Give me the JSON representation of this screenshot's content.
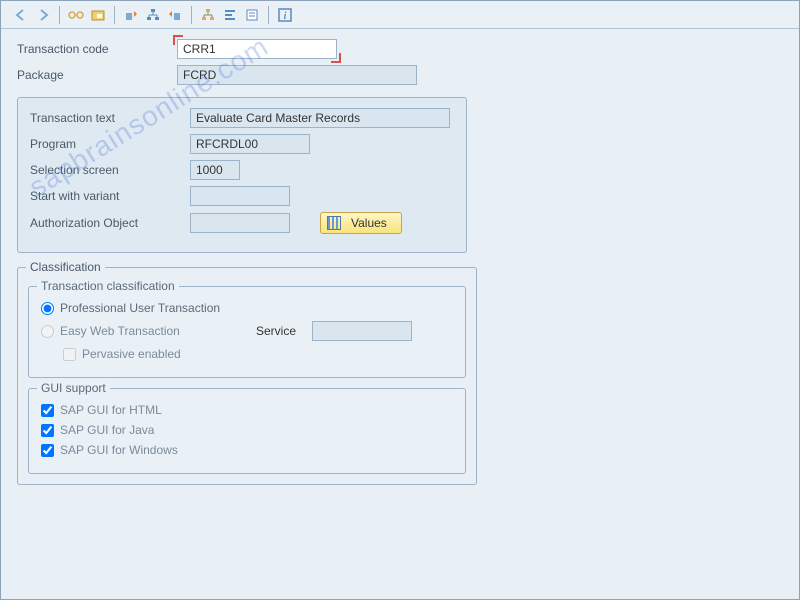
{
  "watermark": "sapbrainsonline.com",
  "toolbar": {
    "icons": [
      "back",
      "forward",
      "glasses",
      "folder-tree",
      "export",
      "hierarchy",
      "import2",
      "org",
      "align-left",
      "template",
      "info"
    ]
  },
  "header": {
    "tcode_label": "Transaction code",
    "tcode_value": "CRR1",
    "package_label": "Package",
    "package_value": "FCRD"
  },
  "detail": {
    "ttext_label": "Transaction text",
    "ttext_value": "Evaluate Card Master Records",
    "program_label": "Program",
    "program_value": "RFCRDL00",
    "selscreen_label": "Selection screen",
    "selscreen_value": "1000",
    "variant_label": "Start with variant",
    "variant_value": "",
    "authobj_label": "Authorization Object",
    "authobj_value": "",
    "values_btn": "Values"
  },
  "classification": {
    "title": "Classification",
    "trans_class_title": "Transaction classification",
    "radio_pro": "Professional User Transaction",
    "radio_easy": "Easy Web Transaction",
    "service_label": "Service",
    "service_value": "",
    "pervasive": "Pervasive enabled",
    "gui_title": "GUI support",
    "gui_html": "SAP GUI for HTML",
    "gui_java": "SAP GUI for Java",
    "gui_win": "SAP GUI for Windows"
  }
}
